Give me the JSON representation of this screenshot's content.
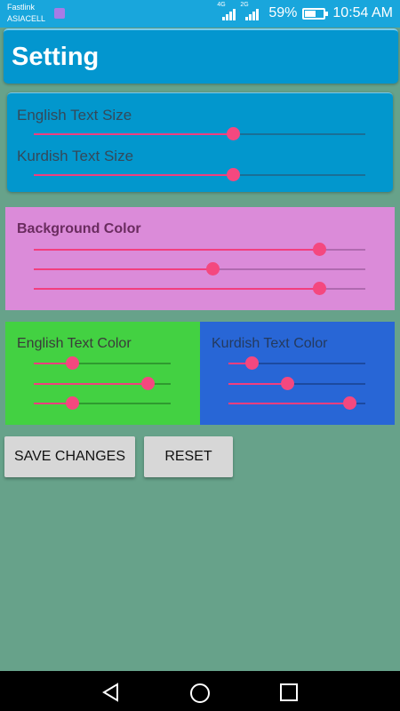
{
  "status_bar": {
    "carrier1": "Fastlink",
    "carrier2": "ASIACELL",
    "net1": "4G",
    "net2": "2G",
    "battery": "59%",
    "battery_level": 0.59,
    "time": "10:54 AM"
  },
  "title": "Setting",
  "text_size": {
    "english_label": "English Text Size",
    "kurdish_label": "Kurdish Text Size",
    "english_value": 0.6,
    "kurdish_value": 0.6
  },
  "background_color": {
    "label": "Background Color",
    "values": [
      0.86,
      0.54,
      0.86
    ]
  },
  "english_color": {
    "label": "English Text Color",
    "values": [
      0.28,
      0.83,
      0.28
    ]
  },
  "kurdish_color": {
    "label": "Kurdish Text Color",
    "values": [
      0.17,
      0.43,
      0.88
    ]
  },
  "buttons": {
    "save": "SAVE CHANGES",
    "reset": "RESET"
  },
  "icons": [
    "back-icon",
    "home-icon",
    "recent-apps-icon"
  ]
}
